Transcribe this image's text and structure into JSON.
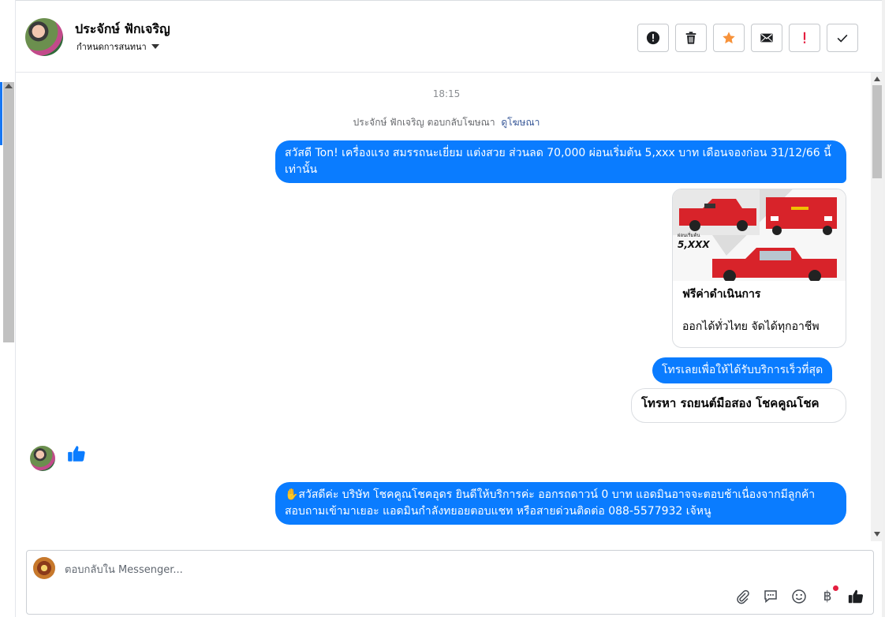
{
  "header": {
    "contact_name": "ประจักษ์ ฟักเจริญ",
    "assign_label": "กำหนดการสนทนา",
    "actions": [
      {
        "icon": "alert-circle-icon",
        "name": "spam-button"
      },
      {
        "icon": "trash-icon",
        "name": "delete-button"
      },
      {
        "icon": "star-icon",
        "name": "star-button"
      },
      {
        "icon": "envelope-icon",
        "name": "mark-unread-button"
      },
      {
        "icon": "exclamation-icon",
        "name": "follow-up-button"
      },
      {
        "icon": "check-icon",
        "name": "done-button"
      }
    ]
  },
  "chat": {
    "timestamp": "18:15",
    "ad_reply_text": "ประจักษ์ ฟักเจริญ ตอบกลับโฆษณา",
    "ad_reply_link": "ดูโฆษณา",
    "messages": [
      {
        "text": "สวัสดี Ton!  เครื่องแรง สมรรถนะเยี่ยม แต่งสวย ส่วนลด 70,000 ผ่อนเริ่มต้น 5,xxx บาท เดือนจองก่อน 31/12/66 นี้เท่านั้น"
      },
      {
        "text": "โทรเลยเพื่อให้ได้รับบริการเร็วที่สุด"
      },
      {
        "text": "โทรหา รถยนต์มือสอง โชคคูณโชค"
      },
      {
        "text": "✋สวัสดีค่ะ บริษัท โชคคูณโชคอุดร ยินดีให้บริการค่ะ ออกรถดาวน์ 0 บาท แอดมินอาจจะตอบช้าเนื่องจากมีลูกค้าสอบถามเข้ามาเยอะ แอดมินกำลังทยอยตอบแชท หรือสายด่วนติดต่อ 088-5577932 เจ้หนู"
      }
    ],
    "card": {
      "image_badge": "5,XXX",
      "title": "ฟรีค่าดำเนินการ",
      "description": "ออกได้ทั่วไทย จัดได้ทุกอาชีพ"
    }
  },
  "composer": {
    "placeholder": "ตอบกลับใน Messenger...",
    "tools": [
      "paperclip-icon",
      "saved-reply-icon",
      "emoji-icon",
      "baht-icon",
      "thumbs-up-icon"
    ],
    "baht_symbol": "฿"
  },
  "colors": {
    "bubble_blue": "#0a7cff",
    "star_orange": "#f7923a",
    "flag_red": "#e41e3f"
  }
}
